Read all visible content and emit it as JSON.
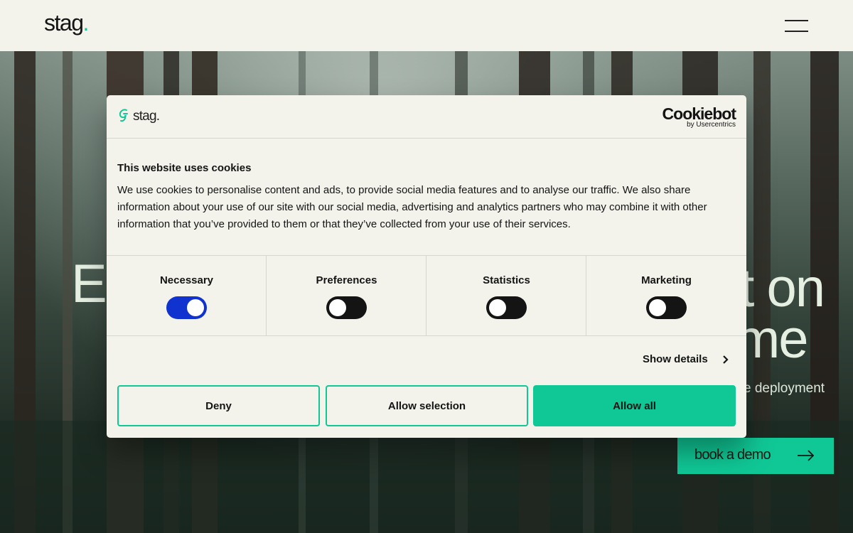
{
  "header": {
    "logo_text": "stag",
    "logo_dot": ".",
    "menu_icon": "hamburger-menu-icon"
  },
  "hero": {
    "title_line1_left": "E",
    "title_line1_right": "et on",
    "title_line2_right": "time",
    "subtitle_fragment": "e deployment",
    "cta_label": "book a demo",
    "cta_icon": "arrow-right-icon"
  },
  "dialog": {
    "brand_text": "stag.",
    "cookiebot_main": "Cookiebot",
    "cookiebot_sub": "by Usercentrics",
    "title": "This website uses cookies",
    "body": "We use cookies to personalise content and ads, to provide social media features and to analyse our traffic. We also share information about your use of our site with our social media, advertising and analytics partners who may combine it with other information that you’ve provided to them or that they’ve collected from your use of their services.",
    "toggles": [
      {
        "label": "Necessary",
        "checked": true
      },
      {
        "label": "Preferences",
        "checked": false
      },
      {
        "label": "Statistics",
        "checked": false
      },
      {
        "label": "Marketing",
        "checked": false
      }
    ],
    "show_details": "Show details",
    "buttons": {
      "deny": "Deny",
      "allow_selection": "Allow selection",
      "allow_all": "Allow all"
    }
  },
  "colors": {
    "accent": "#10c896",
    "toggle_on": "#1032cf",
    "toggle_off": "#141414",
    "panel_bg": "#f3f3ec"
  }
}
